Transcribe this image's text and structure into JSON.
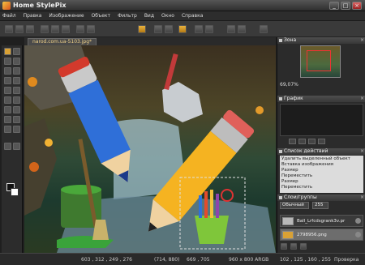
{
  "app": {
    "title": "Home StylePix"
  },
  "menu": [
    "Файл",
    "Правка",
    "Изображение",
    "Объект",
    "Фильтр",
    "Вид",
    "Окно",
    "Справка"
  ],
  "document": {
    "tab_label": "narod.com.ua-5103.jpg*"
  },
  "panels": {
    "navigator": {
      "title": "Зона",
      "zoom": "69,07%"
    },
    "histogram": {
      "title": "График"
    },
    "history": {
      "title": "Список действий",
      "items": [
        "Удалить выделенный объект",
        "Вставка изображения",
        "Размер",
        "Переместить",
        "Размер",
        "Переместить"
      ]
    },
    "layers": {
      "title": "Слои/группы",
      "blend_mode": "Обычный",
      "opacity": "255",
      "items": [
        {
          "name": "Ball_Lrfcdsgrank3v.pr",
          "selected": false
        },
        {
          "name": "2798956.png",
          "selected": true
        }
      ]
    }
  },
  "status": {
    "cursor": "603 , 312 , 249 , 276",
    "size": "(714, 880)",
    "coords": "669 , 705",
    "image_info": "960 x 800 ARGB",
    "right_info": "102 , 125 , 160 , 255",
    "zoom_info": "Проверка"
  },
  "colors": {
    "accent": "#d9a135",
    "bg": "#2b2b2b"
  }
}
